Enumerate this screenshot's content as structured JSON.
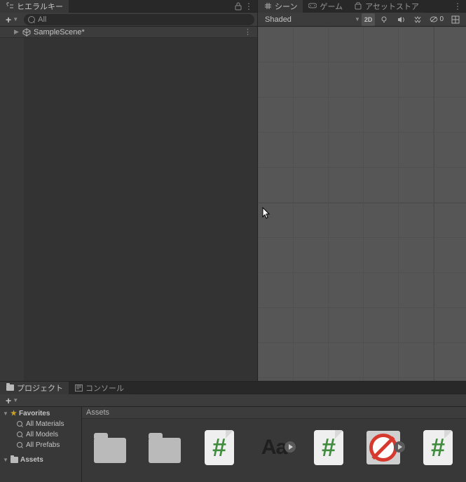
{
  "hierarchy": {
    "tab_label": "ヒエラルキー",
    "search_placeholder": "All",
    "scene_item": "SampleScene*"
  },
  "scene": {
    "tab_scene": "シーン",
    "tab_game": "ゲーム",
    "tab_assetstore": "アセットストア",
    "shading_mode": "Shaded",
    "btn_2d": "2D",
    "gizmo_count": "0"
  },
  "project": {
    "tab_project": "プロジェクト",
    "tab_console": "コンソール",
    "favorites_label": "Favorites",
    "fav_materials": "All Materials",
    "fav_models": "All Models",
    "fav_prefabs": "All Prefabs",
    "assets_label": "Assets",
    "breadcrumb": "Assets"
  }
}
